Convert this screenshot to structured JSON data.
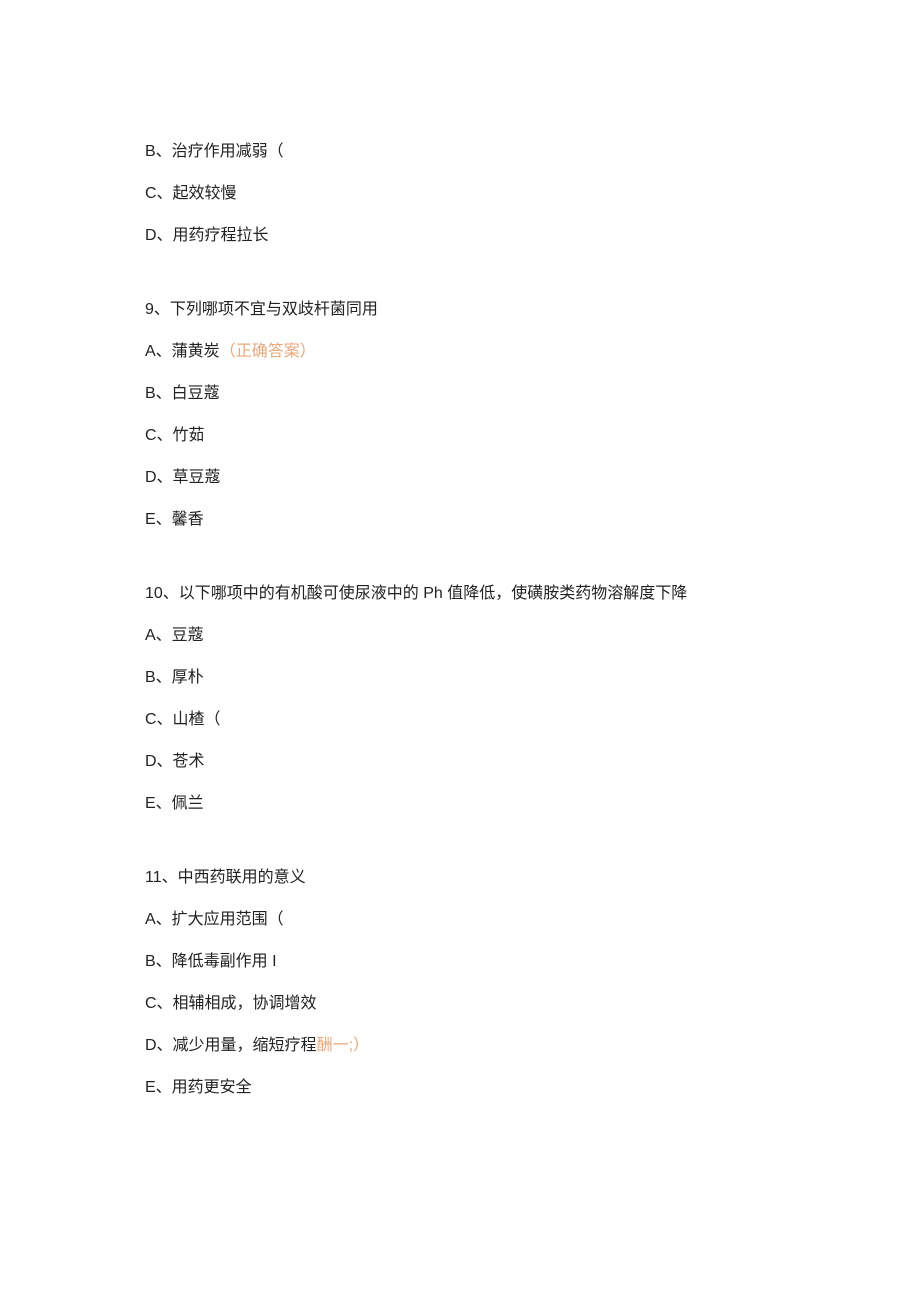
{
  "block1": {
    "optionB": "B、治疗作用减弱（",
    "optionC": "C、起效较慢",
    "optionD": "D、用药疗程拉长"
  },
  "block2": {
    "question": "9、下列哪项不宜与双歧杆菌同用",
    "optionA_prefix": "A、蒲黄炭",
    "optionA_answer": "（正确答案）",
    "optionB": "B、白豆蔻",
    "optionC": "C、竹茹",
    "optionD": "D、草豆蔻",
    "optionE": "E、馨香"
  },
  "block3": {
    "question": "10、以下哪项中的有机酸可使尿液中的 Ph 值降低，使磺胺类药物溶解度下降",
    "optionA": "A、豆蔻",
    "optionB": "B、厚朴",
    "optionC": "C、山楂（",
    "optionD": "D、苍术",
    "optionE": "E、佩兰"
  },
  "block4": {
    "question": "11、中西药联用的意义",
    "optionA": "A、扩大应用范围（",
    "optionB": "B、降低毒副作用 I",
    "optionC": "C、相辅相成，协调增效",
    "optionD_prefix": "D、减少用量，缩短疗程",
    "optionD_suffix": "酬一;）",
    "optionE": "E、用药更安全"
  }
}
